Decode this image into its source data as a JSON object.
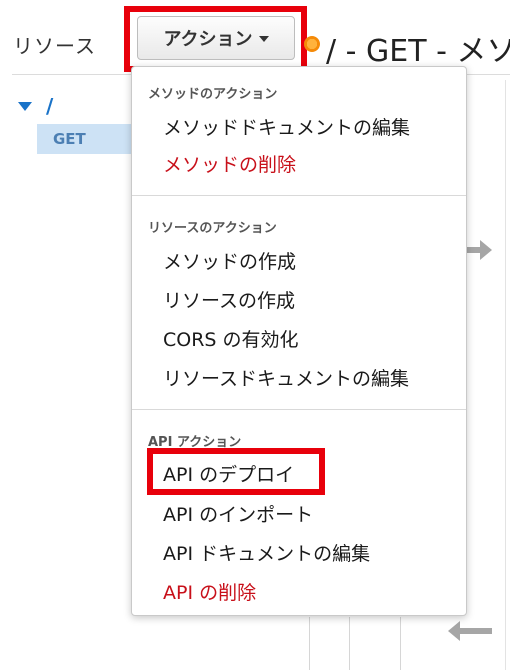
{
  "sidebar": {
    "title": "リソース",
    "tree": {
      "root_label": "/",
      "method_label": "GET"
    }
  },
  "toolbar": {
    "actions_label": "アクション"
  },
  "header": {
    "title": "/ - GET - メソ"
  },
  "dropdown": {
    "sections": [
      {
        "header": "メソッドのアクション",
        "items": [
          {
            "label": "メソッドドキュメントの編集",
            "danger": false
          },
          {
            "label": "メソッドの削除",
            "danger": true
          }
        ]
      },
      {
        "header": "リソースのアクション",
        "items": [
          {
            "label": "メソッドの作成",
            "danger": false
          },
          {
            "label": "リソースの作成",
            "danger": false
          },
          {
            "label": "CORS の有効化",
            "danger": false
          },
          {
            "label": "リソースドキュメントの編集",
            "danger": false
          }
        ]
      },
      {
        "header": "API アクション",
        "items": [
          {
            "label": "API のデプロイ",
            "danger": false
          },
          {
            "label": "API のインポート",
            "danger": false
          },
          {
            "label": "API ドキュメントの編集",
            "danger": false
          },
          {
            "label": "API の削除",
            "danger": true
          }
        ]
      }
    ]
  },
  "colors": {
    "highlight": "#e8000b",
    "danger": "#c8101a",
    "link": "#1a73c8",
    "selected_bg": "#cde2f5"
  }
}
